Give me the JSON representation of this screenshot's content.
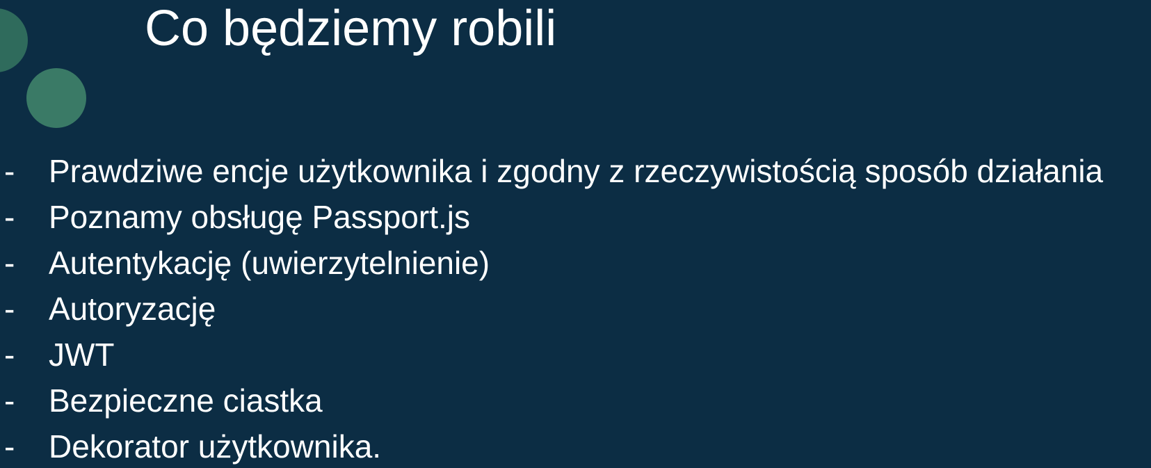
{
  "slide": {
    "title": "Co będziemy robili",
    "bullet_marker": "-",
    "items": [
      "Prawdziwe encje użytkownika i zgodny z rzeczywistością sposób działania",
      "Poznamy obsługę Passport.js",
      "Autentykację (uwierzytelnienie)",
      "Autoryzację",
      "JWT",
      "Bezpieczne ciastka",
      "Dekorator użytkownika."
    ]
  }
}
